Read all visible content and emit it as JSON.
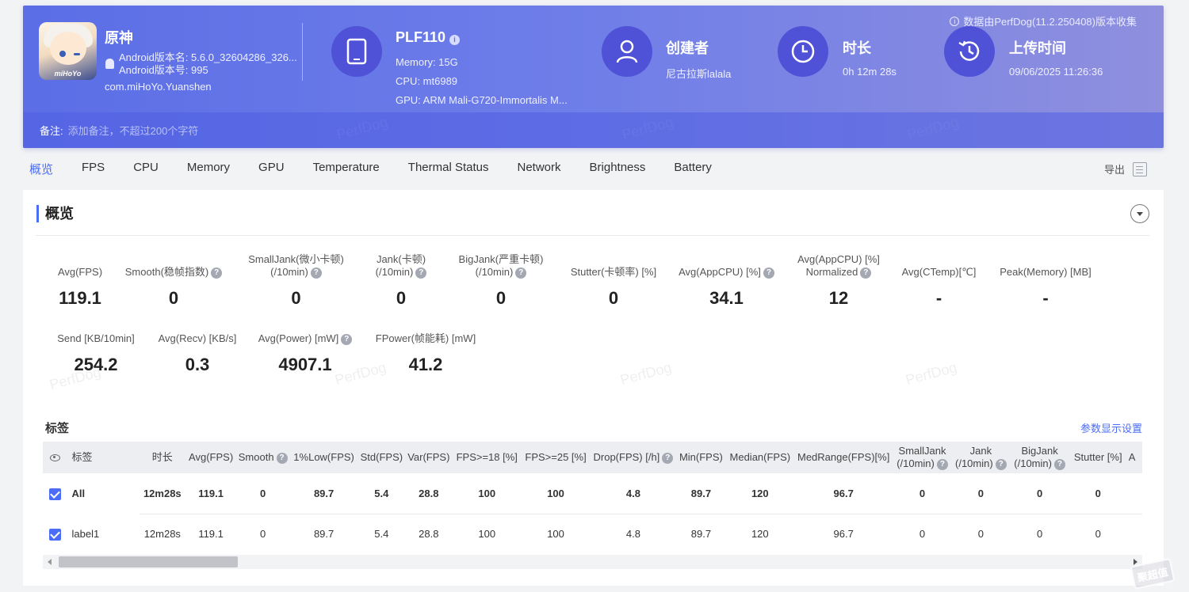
{
  "header": {
    "source_note": "数据由PerfDog(11.2.250408)版本收集",
    "app": {
      "name": "原神",
      "icon_logo_text": "miHoYo",
      "version_name": "Android版本名: 5.6.0_32604286_326...",
      "version_code": "Android版本号: 995",
      "package": "com.miHoYo.Yuanshen"
    },
    "device": {
      "model": "PLF110",
      "memory": "Memory: 15G",
      "cpu": "CPU: mt6989",
      "gpu": "GPU: ARM Mali-G720-Immortalis M..."
    },
    "creator": {
      "title": "创建者",
      "value": "尼古拉斯lalala"
    },
    "duration": {
      "title": "时长",
      "value": "0h 12m 28s"
    },
    "upload": {
      "title": "上传时间",
      "value": "09/06/2025 11:26:36"
    },
    "remark": {
      "label": "备注:",
      "placeholder": "添加备注，不超过200个字符"
    },
    "watermark": "PerfDog"
  },
  "tabs": [
    "概览",
    "FPS",
    "CPU",
    "Memory",
    "GPU",
    "Temperature",
    "Thermal Status",
    "Network",
    "Brightness",
    "Battery"
  ],
  "active_tab": "概览",
  "export_label": "导出",
  "overview": {
    "title": "概览",
    "metrics_row1": [
      {
        "label": "Avg(FPS)",
        "value": "119.1"
      },
      {
        "label": "Smooth(稳帧指数)",
        "value": "0",
        "help": true
      },
      {
        "label": "SmallJank(微小卡顿)",
        "label2": "(/10min)",
        "value": "0",
        "help": true
      },
      {
        "label": "Jank(卡顿)",
        "label2": "(/10min)",
        "value": "0",
        "help": true
      },
      {
        "label": "BigJank(严重卡顿)",
        "label2": "(/10min)",
        "value": "0",
        "help": true
      },
      {
        "label": "Stutter(卡顿率) [%]",
        "value": "0"
      },
      {
        "label": "Avg(AppCPU) [%]",
        "value": "34.1",
        "help": true
      },
      {
        "label": "Avg(AppCPU) [%]",
        "label2": "Normalized",
        "value": "12",
        "help": true
      },
      {
        "label": "Avg(CTemp)[℃]",
        "value": "-"
      },
      {
        "label": "Peak(Memory) [MB]",
        "value": "-"
      }
    ],
    "metrics_row2": [
      {
        "label": "Send [KB/10min]",
        "value": "254.2"
      },
      {
        "label": "Avg(Recv) [KB/s]",
        "value": "0.3"
      },
      {
        "label": "Avg(Power) [mW]",
        "value": "4907.1",
        "help": true
      },
      {
        "label": "FPower(帧能耗) [mW]",
        "value": "41.2"
      }
    ],
    "tags_title": "标签",
    "param_link": "参数显示设置"
  },
  "table": {
    "columns": [
      "标签",
      "时长",
      "Avg(FPS)",
      "Smooth",
      "1%Low(FPS)",
      "Std(FPS)",
      "Var(FPS)",
      "FPS>=18 [%]",
      "FPS>=25 [%]",
      "Drop(FPS) [/h]",
      "Min(FPS)",
      "Median(FPS)",
      "MedRange(FPS)[%]",
      "SmallJank\n(/10min)",
      "Jank\n(/10min)",
      "BigJank\n(/10min)",
      "Stutter [%]",
      "A"
    ],
    "rows": [
      {
        "label": "All",
        "cells": [
          "12m28s",
          "119.1",
          "0",
          "89.7",
          "5.4",
          "28.8",
          "100",
          "100",
          "4.8",
          "89.7",
          "120",
          "96.7",
          "0",
          "0",
          "0",
          "0",
          ""
        ]
      },
      {
        "label": "label1",
        "cells": [
          "12m28s",
          "119.1",
          "0",
          "89.7",
          "5.4",
          "28.8",
          "100",
          "100",
          "4.8",
          "89.7",
          "120",
          "96.7",
          "0",
          "0",
          "0",
          "0",
          ""
        ]
      }
    ]
  },
  "corner_watermark": "聚超值"
}
